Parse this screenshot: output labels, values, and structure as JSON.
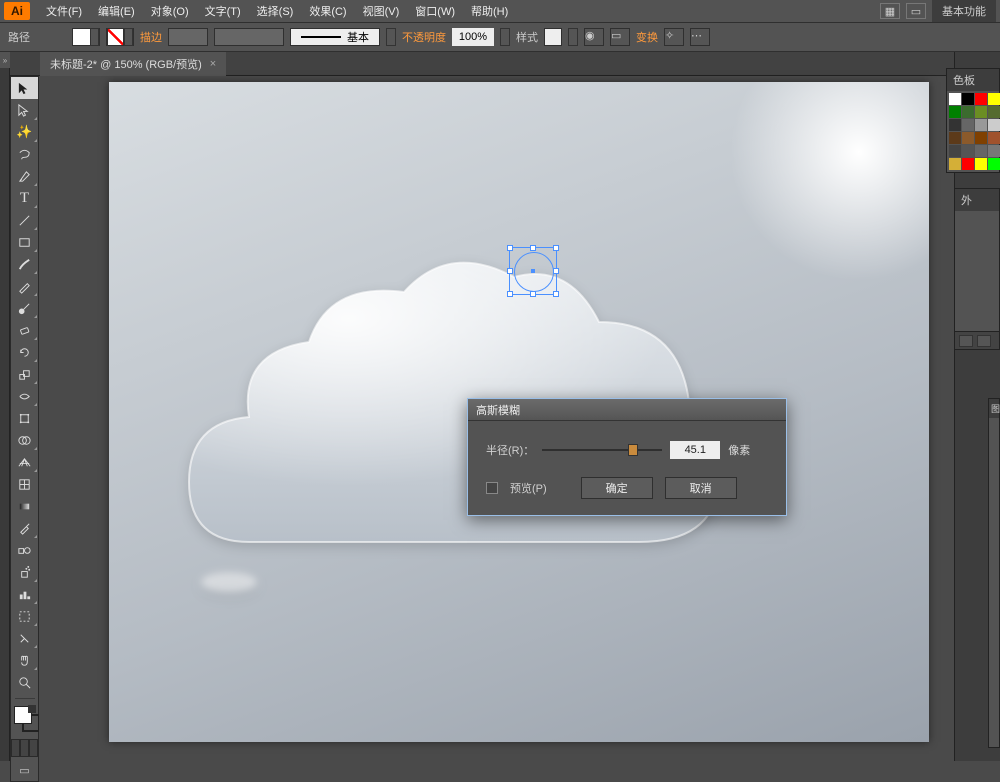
{
  "app": {
    "logo": "Ai"
  },
  "menu": {
    "file": "文件(F)",
    "edit": "编辑(E)",
    "object": "对象(O)",
    "type": "文字(T)",
    "select": "选择(S)",
    "effect": "效果(C)",
    "view": "视图(V)",
    "window": "窗口(W)",
    "help": "帮助(H)"
  },
  "workspace": "基本功能",
  "optbar": {
    "selection_label": "路径",
    "stroke_label": "描边",
    "stroke_style_label": "基本",
    "opacity_label": "不透明度",
    "opacity_value": "100%",
    "style_label": "样式",
    "transform_label": "变换"
  },
  "doctab": {
    "title": "未标题-2* @ 150% (RGB/预览)",
    "close": "×"
  },
  "dialog": {
    "title": "高斯模糊",
    "radius_label": "半径(R)：",
    "radius_value": "45.1",
    "unit": "像素",
    "preview_label": "预览(P)",
    "ok": "确定",
    "cancel": "取消"
  },
  "panels": {
    "swatches_title": "色板",
    "appearance_title": "外",
    "layers_title": "图"
  },
  "swatch_colors": [
    "#ffffff",
    "#000000",
    "#ff0000",
    "#ffff00",
    "#008000",
    "#3b6b2e",
    "#6b8e23",
    "#556b2f",
    "#333333",
    "#666666",
    "#999999",
    "#cccccc",
    "#5c3a1a",
    "#8b5a2b",
    "#804000",
    "#a0522d",
    "#444444",
    "#555555",
    "#666666",
    "#777777",
    "#d4af37",
    "#ff0000",
    "#ffff00",
    "#00ff00"
  ]
}
